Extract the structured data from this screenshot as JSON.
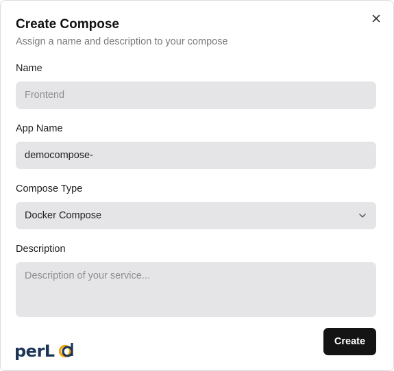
{
  "dialog": {
    "title": "Create Compose",
    "subtitle": "Assign a name and description to your compose",
    "close_icon": "close-icon"
  },
  "form": {
    "name": {
      "label": "Name",
      "value": "",
      "placeholder": "Frontend"
    },
    "app_name": {
      "label": "App Name",
      "value": "democompose-",
      "placeholder": ""
    },
    "compose_type": {
      "label": "Compose Type",
      "selected": "Docker Compose",
      "icon": "chevron-down-icon"
    },
    "description": {
      "label": "Description",
      "value": "",
      "placeholder": "Description of your service..."
    }
  },
  "footer": {
    "logo_text": "perLod",
    "create_label": "Create"
  },
  "colors": {
    "field_bg": "#e5e5e7",
    "button_bg": "#141414",
    "logo_dark": "#1d3557",
    "logo_accent": "#f4a300"
  }
}
